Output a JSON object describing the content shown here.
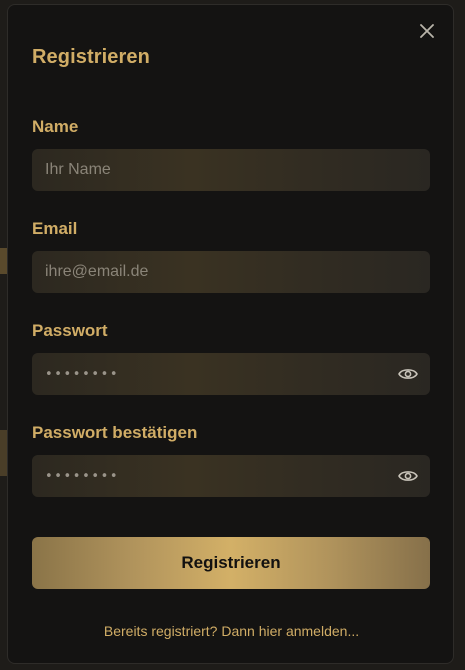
{
  "modal": {
    "title": "Registrieren",
    "close_icon": "close-icon"
  },
  "fields": {
    "name": {
      "label": "Name",
      "placeholder": "Ihr Name",
      "value": ""
    },
    "email": {
      "label": "Email",
      "placeholder": "ihre@email.de",
      "value": ""
    },
    "password": {
      "label": "Passwort",
      "masked_value": "••••••••",
      "toggle_icon": "eye-icon"
    },
    "password_confirm": {
      "label": "Passwort bestätigen",
      "masked_value": "••••••••",
      "toggle_icon": "eye-icon"
    }
  },
  "submit": {
    "label": "Registrieren"
  },
  "login_link": {
    "text": "Bereits registriert? Dann hier anmelden..."
  },
  "colors": {
    "accent": "#d1ad66",
    "modal_background": "#141312",
    "input_background": "#332d22",
    "button_gradient_center": "#d3b067"
  }
}
